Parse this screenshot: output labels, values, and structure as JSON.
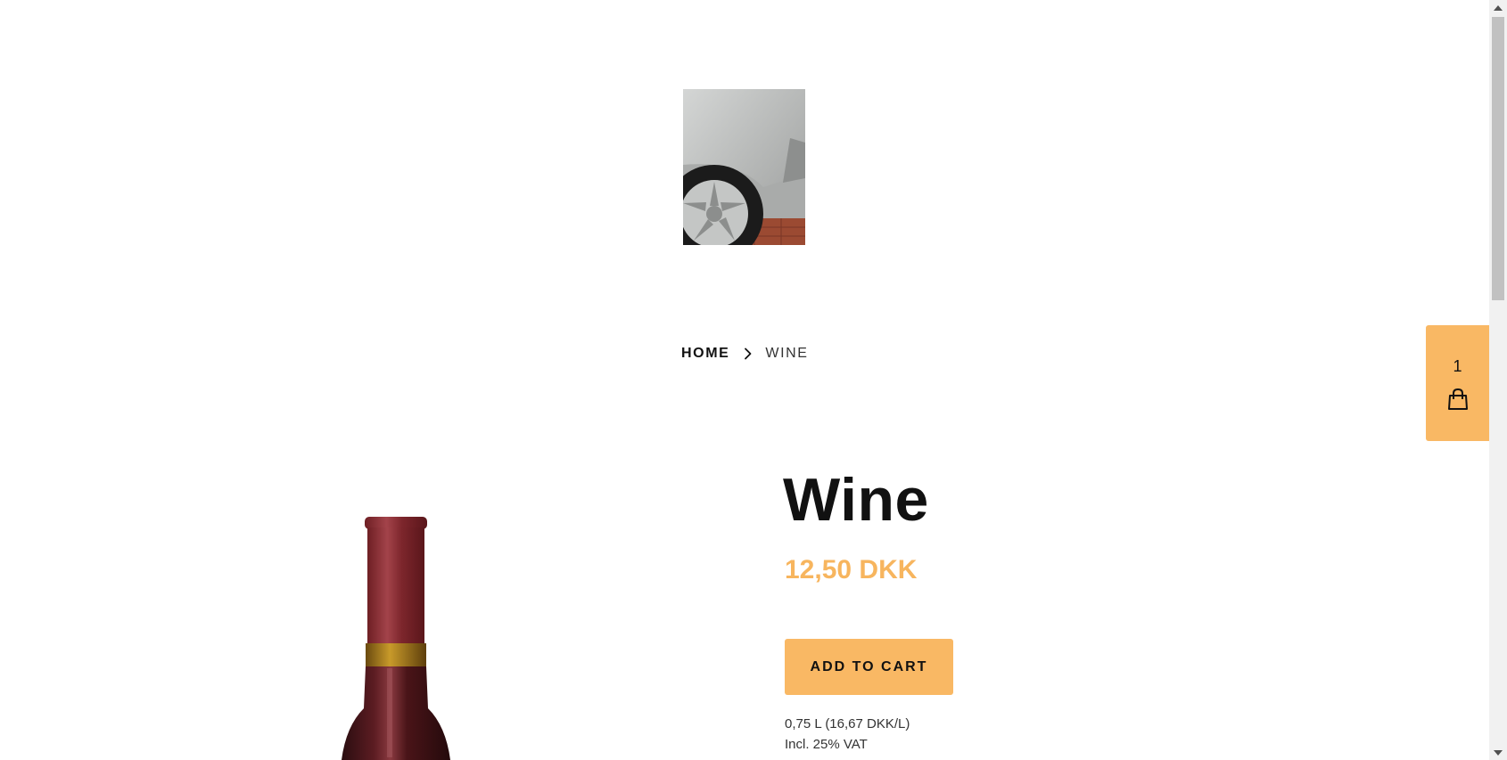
{
  "header": {
    "logo_image": "car-wheel-photo"
  },
  "breadcrumb": {
    "home_label": "HOME",
    "separator_icon": "chevron-right-icon",
    "current_label": "WINE"
  },
  "product": {
    "image": "wine-bottle-photo",
    "title": "Wine",
    "price": "12,50 DKK",
    "add_to_cart_label": "ADD TO CART",
    "unit_price": "0,75 L (16,67 DKK/L)",
    "vat_note": "Incl. 25% VAT"
  },
  "cart": {
    "count": "1",
    "icon": "shopping-bag-icon"
  },
  "colors": {
    "accent": "#f9b864",
    "price": "#f7b55e",
    "text": "#111111"
  }
}
